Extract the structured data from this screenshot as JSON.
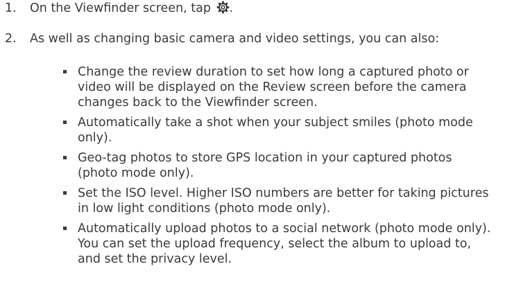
{
  "steps": [
    {
      "number": "1.",
      "text_before_icon": "On the Viewfinder screen, tap ",
      "icon": "settings-gear-icon",
      "text_after_icon": "."
    },
    {
      "number": "2.",
      "text": "As well as changing basic camera and video settings, you can also:"
    }
  ],
  "bullets": [
    "Change the review duration to set how long a captured photo or video will be displayed on the Review screen before the camera changes back to the Viewfinder screen.",
    "Automatically take a shot when your subject smiles (photo mode only).",
    "Geo-tag photos to store GPS location in your captured photos (photo mode only).",
    "Set the ISO level. Higher ISO numbers are better for taking pictures in low light conditions (photo mode only).",
    "Automatically upload photos to a social network (photo mode only). You can set the upload frequency, select the album to upload to, and set the privacy level."
  ]
}
